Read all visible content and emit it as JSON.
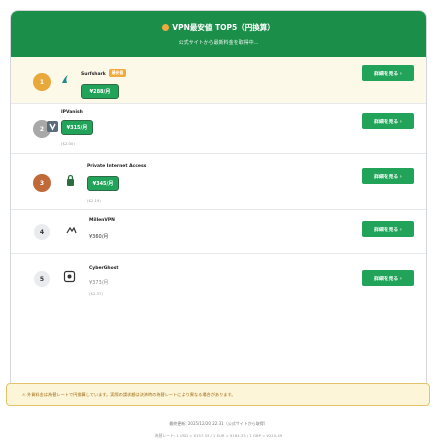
{
  "header": {
    "title": "VPN最安値 TOP5（円換算）",
    "subtitle": "公式サイトから最新料金を取得中..."
  },
  "colors": {
    "brand": "#1b8f49",
    "cta": "#22a35a",
    "featured_bg": "#fdf9e8",
    "notice_bg": "#fdf5d8",
    "best_badge": "#f2a93b"
  },
  "vpns": [
    {
      "rank": "1",
      "name": "Surfshark",
      "badge": "最安値",
      "price": "¥288/月",
      "sub": "",
      "cta": "詳細を見る ›",
      "logo_icon": "surfshark-logo-icon"
    },
    {
      "rank": "2",
      "name": "IPVanish",
      "badge": "",
      "price": "¥315/月",
      "sub": "($2.00)",
      "cta": "詳細を見る ›",
      "logo_icon": "ipvanish-logo-icon"
    },
    {
      "rank": "3",
      "name": "Private Internet Access",
      "badge": "",
      "price": "¥345/月",
      "sub": "($2.19)",
      "cta": "詳細を見る ›",
      "logo_icon": "pia-logo-icon"
    },
    {
      "rank": "4",
      "name": "MillenVPN",
      "badge": "",
      "price": "¥360/月",
      "sub": "",
      "cta": "詳細を見る ›",
      "logo_icon": "millenvpn-logo-icon"
    },
    {
      "rank": "5",
      "name": "CyberGhost",
      "badge": "",
      "price": "¥373/月",
      "sub": "($2.37)",
      "cta": "詳細を見る ›",
      "logo_icon": "cyberghost-logo-icon"
    }
  ],
  "notice": "⚠ 外貨料金は為替レートで円換算しています。実際の請求額は決済時の為替レートにより異なる場合があります。",
  "footer": {
    "updated": "最終更新: 2025/12/20 22:31（公式サイトから取得）",
    "rates": "為替レート: 1 USD = ¥157.33 / 1 EUR = ¥184.33 / 1 GBP = ¥210.49"
  }
}
